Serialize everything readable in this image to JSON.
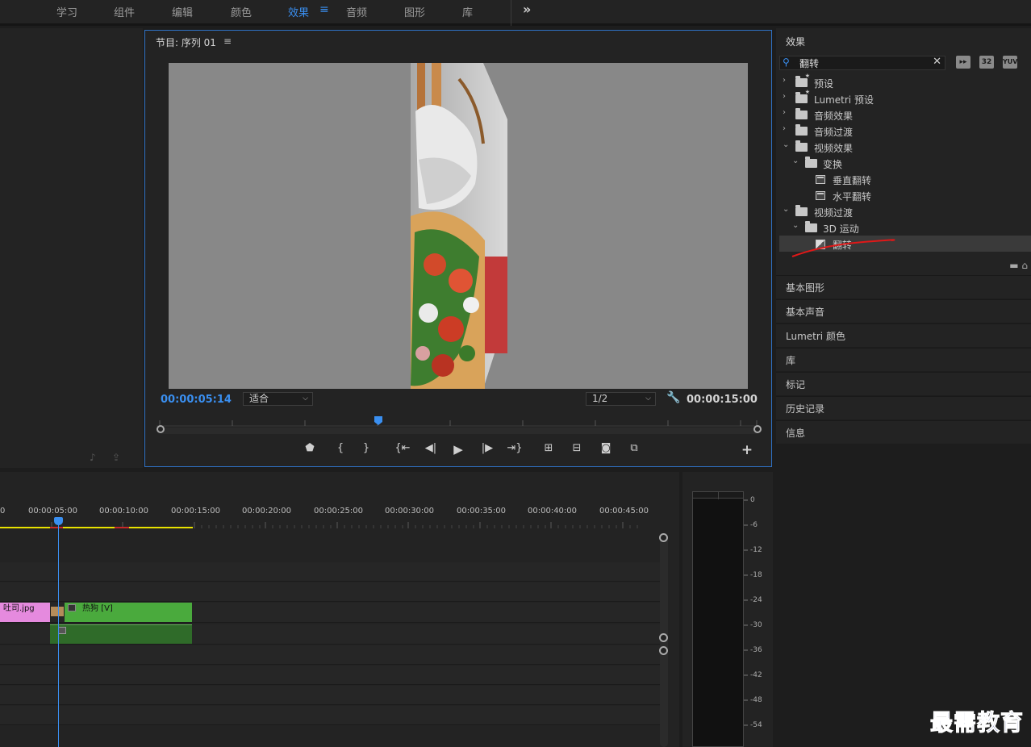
{
  "workspaces": [
    "学习",
    "组件",
    "编辑",
    "颜色",
    "效果",
    "音频",
    "图形",
    "库"
  ],
  "active_workspace": "效果",
  "program_monitor": {
    "title": "节目: 序列 01",
    "current_timecode": "00:00:05:14",
    "fit_option": "适合",
    "resolution": "1/2",
    "duration_timecode": "00:00:15:00"
  },
  "effects_panel": {
    "title": "效果",
    "search_value": "翻转",
    "tags": [
      "32",
      "YUV"
    ],
    "tree": [
      {
        "label": "预设",
        "depth": 0,
        "kind": "folder-star",
        "expanded": false
      },
      {
        "label": "Lumetri 预设",
        "depth": 0,
        "kind": "folder-star",
        "expanded": false
      },
      {
        "label": "音频效果",
        "depth": 0,
        "kind": "folder",
        "expanded": false
      },
      {
        "label": "音频过渡",
        "depth": 0,
        "kind": "folder",
        "expanded": false
      },
      {
        "label": "视频效果",
        "depth": 0,
        "kind": "folder",
        "expanded": true
      },
      {
        "label": "变换",
        "depth": 1,
        "kind": "folder",
        "expanded": true
      },
      {
        "label": "垂直翻转",
        "depth": 2,
        "kind": "effect"
      },
      {
        "label": "水平翻转",
        "depth": 2,
        "kind": "effect"
      },
      {
        "label": "视频过渡",
        "depth": 0,
        "kind": "folder",
        "expanded": true
      },
      {
        "label": "3D 运动",
        "depth": 1,
        "kind": "folder",
        "expanded": true
      },
      {
        "label": "翻转",
        "depth": 2,
        "kind": "transition",
        "selected": true
      }
    ]
  },
  "side_panels": [
    "基本图形",
    "基本声音",
    "Lumetri 颜色",
    "库",
    "标记",
    "历史记录",
    "信息"
  ],
  "timeline": {
    "ruler_labels": [
      "00:00:05:00",
      "00:00:10:00",
      "00:00:15:00",
      "00:00:20:00",
      "00:00:25:00",
      "00:00:30:00",
      "00:00:35:00",
      "00:00:40:00",
      "00:00:45:00"
    ],
    "ruler_zero": "0",
    "clips": {
      "toast": "吐司.jpg",
      "hotdog": "热狗 [V]"
    }
  },
  "audio_meter": {
    "db_labels": [
      "0",
      "-6",
      "-12",
      "-18",
      "-24",
      "-30",
      "-36",
      "-42",
      "-48",
      "-54"
    ]
  },
  "watermark": "最需教育",
  "colors": {
    "accent": "#3a8ff0",
    "clip_pink": "#e58ade",
    "clip_green": "#4aaa3d",
    "work_area": "#e8e200"
  }
}
